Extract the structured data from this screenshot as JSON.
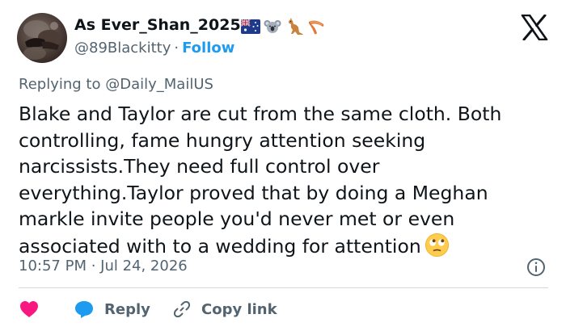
{
  "author": {
    "display_name": "As Ever_Shan_2025",
    "name_emojis": [
      "flag-australia-icon",
      "koala-icon",
      "kangaroo-icon",
      "boomerang-icon"
    ],
    "handle": "@89Blackitty",
    "separator": "·",
    "follow_label": "Follow"
  },
  "reply_context": {
    "prefix": "Replying to",
    "mention": "@Daily_MailUS"
  },
  "tweet": {
    "text": "Blake and Taylor are cut from the same cloth. Both\ncontrolling, fame hungry attention seeking\nnarcissists.They need full control over\neverything.Taylor proved that by doing a Meghan\nmarkle invite people you'd never met or even\nassociated with to a wedding for  attention",
    "trailing_emoji": "face-with-rolling-eyes-icon",
    "timestamp": "10:57 PM · Jul 24, 2026"
  },
  "actions": {
    "like_icon": "heart-icon",
    "reply_label": "Reply",
    "copy_label": "Copy link"
  },
  "colors": {
    "accent": "#1d9bf0",
    "like": "#f91880",
    "secondary_text": "#536471",
    "primary_text": "#0f1419",
    "divider": "#cfd9de"
  }
}
